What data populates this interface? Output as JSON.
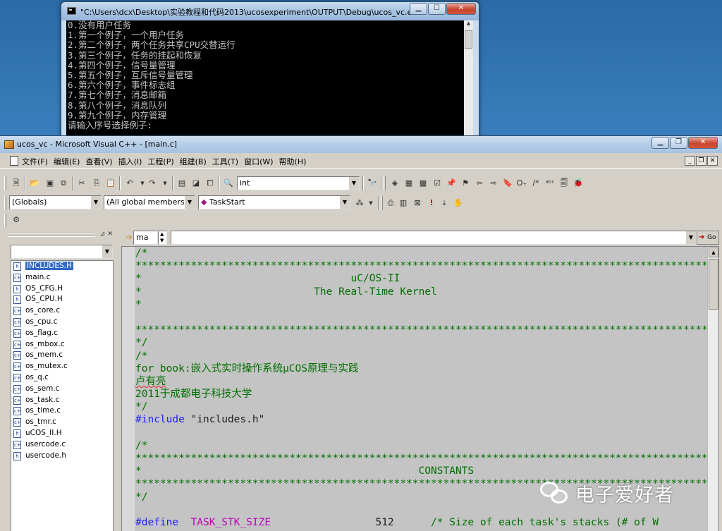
{
  "console": {
    "title": "\"C:\\Users\\dcx\\Desktop\\实验教程和代码2013\\ucosexperiment\\OUTPUT\\Debug\\ucos_vc.exe\"",
    "lines": [
      "0.没有用户任务",
      "1.第一个例子，一个用户任务",
      "2.第二个例子，两个任务共享CPU交替运行",
      "3.第三个例子，任务的挂起和恢复",
      "4.第四个例子，信号量管理",
      "5.第五个例子，互斥信号量管理",
      "6.第六个例子，事件标志组",
      "7.第七个例子，消息邮箱",
      "8.第八个例子，消息队列",
      "9.第九个例子，内存管理",
      "请输入序号选择例子:"
    ]
  },
  "vc": {
    "title": "ucos_vc - Microsoft Visual C++ - [main.c]",
    "menu": [
      "文件(F)",
      "编辑(E)",
      "查看(V)",
      "插入(I)",
      "工程(P)",
      "组建(B)",
      "工具(T)",
      "窗口(W)",
      "帮助(H)"
    ],
    "find_value": "int",
    "wizard": {
      "class_value": "(Globals)",
      "filter_value": "(All global members",
      "member_value": "TaskStart"
    },
    "nav_combo_value": "ma",
    "go_label": "Go"
  },
  "workspace": {
    "files": [
      {
        "name": "INCLUDES.H",
        "type": "h",
        "selected": true
      },
      {
        "name": "main.c",
        "type": "c"
      },
      {
        "name": "OS_CFG.H",
        "type": "h"
      },
      {
        "name": "OS_CPU.H",
        "type": "h"
      },
      {
        "name": "os_core.c",
        "type": "c"
      },
      {
        "name": "os_cpu.c",
        "type": "c"
      },
      {
        "name": "os_flag.c",
        "type": "c"
      },
      {
        "name": "os_mbox.c",
        "type": "c"
      },
      {
        "name": "os_mem.c",
        "type": "c"
      },
      {
        "name": "os_mutex.c",
        "type": "c"
      },
      {
        "name": "os_q.c",
        "type": "c"
      },
      {
        "name": "os_sem.c",
        "type": "c"
      },
      {
        "name": "os_task.c",
        "type": "c"
      },
      {
        "name": "os_time.c",
        "type": "c"
      },
      {
        "name": "os_tmr.c",
        "type": "c"
      },
      {
        "name": "uCOS_II.H",
        "type": "h"
      },
      {
        "name": "usercode.c",
        "type": "c"
      },
      {
        "name": "usercode.h",
        "type": "h"
      }
    ]
  },
  "code": {
    "stars": "**********************************************************************************************",
    "l_open": "/*",
    "l_close": "*/",
    "l_title1": "*                                  uC/OS-II",
    "l_title2": "*                            The Real-Time Kernel",
    "l_star": "*",
    "l_book": "for book:嵌入式实时操作系统μCOS原理与实践",
    "l_author": "卢有亮",
    "l_school": "2011于成都电子科技大学",
    "l_include_kw": "#include",
    "l_include_arg": " \"includes.h\"",
    "l_constants": "*                                             CONSTANTS",
    "l_define_kw": "#define",
    "l_define_name": "  TASK_STK_SIZE",
    "l_define_val": "                 512",
    "l_define_cm": "      /* Size of each task's stacks (# of W"
  },
  "watermark": {
    "text": "电子爱好者"
  },
  "colors": {
    "editor_bg": "#c4c4c4",
    "comment": "#007000",
    "keyword": "#2020ff",
    "macro": "#c000c0",
    "console_bg": "#000000",
    "console_text": "#c0c0c0",
    "selection": "#3169c6"
  },
  "icons": [
    "cmd-icon",
    "vc-app-icon",
    "doc-icon",
    "new-file-icon",
    "open-icon",
    "save-icon",
    "save-all-icon",
    "cut-icon",
    "copy-icon",
    "paste-icon",
    "undo-icon",
    "redo-icon",
    "workspace-icon",
    "output-icon",
    "windows-icon",
    "find-in-files-icon",
    "find-icon",
    "compile-icon",
    "build-icon",
    "stop-build-icon",
    "execute-icon",
    "breakpoint-icon",
    "go-icon",
    "header-file-icon",
    "c-file-icon",
    "wechat-logo"
  ]
}
